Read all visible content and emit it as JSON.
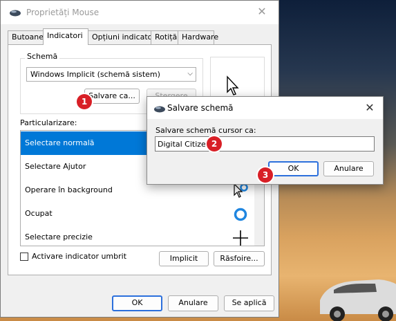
{
  "main_window": {
    "title": "Proprietăți Mouse",
    "tabs": [
      {
        "label": "Butoane"
      },
      {
        "label": "Indicatori"
      },
      {
        "label": "Opțiuni indicatori"
      },
      {
        "label": "Rotiță"
      },
      {
        "label": "Hardware"
      }
    ],
    "active_tab": "Indicatori",
    "scheme": {
      "group_label": "Schemă",
      "selected_value": "Windows Implicit (schemă sistem)",
      "save_as_label": "Salvare ca...",
      "delete_label": "Ștergere"
    },
    "customize": {
      "label": "Particularizare:",
      "items": [
        {
          "label": "Selectare normală",
          "icon": "arrow-cursor-icon",
          "selected": true
        },
        {
          "label": "Selectare Ajutor",
          "icon": "help-cursor-icon",
          "selected": false
        },
        {
          "label": "Operare în background",
          "icon": "working-in-background-cursor-icon",
          "selected": false
        },
        {
          "label": "Ocupat",
          "icon": "busy-cursor-icon",
          "selected": false
        },
        {
          "label": "Selectare precizie",
          "icon": "precision-select-cursor-icon",
          "selected": false
        }
      ]
    },
    "shadow_checkbox_label": "Activare indicator umbrit",
    "shadow_checked": false,
    "default_label": "Implicit",
    "browse_label": "Răsfoire...",
    "footer": {
      "ok": "OK",
      "cancel": "Anulare",
      "apply": "Se aplică"
    }
  },
  "dialog": {
    "title": "Salvare schemă",
    "prompt": "Salvare schemă cursor ca:",
    "input_value": "Digital Citizen",
    "ok": "OK",
    "cancel": "Anulare"
  },
  "badges": [
    "1",
    "2",
    "3"
  ],
  "colors": {
    "selection": "#0078d7",
    "badge": "#d81f26",
    "focus_border": "#2b6fdc"
  }
}
